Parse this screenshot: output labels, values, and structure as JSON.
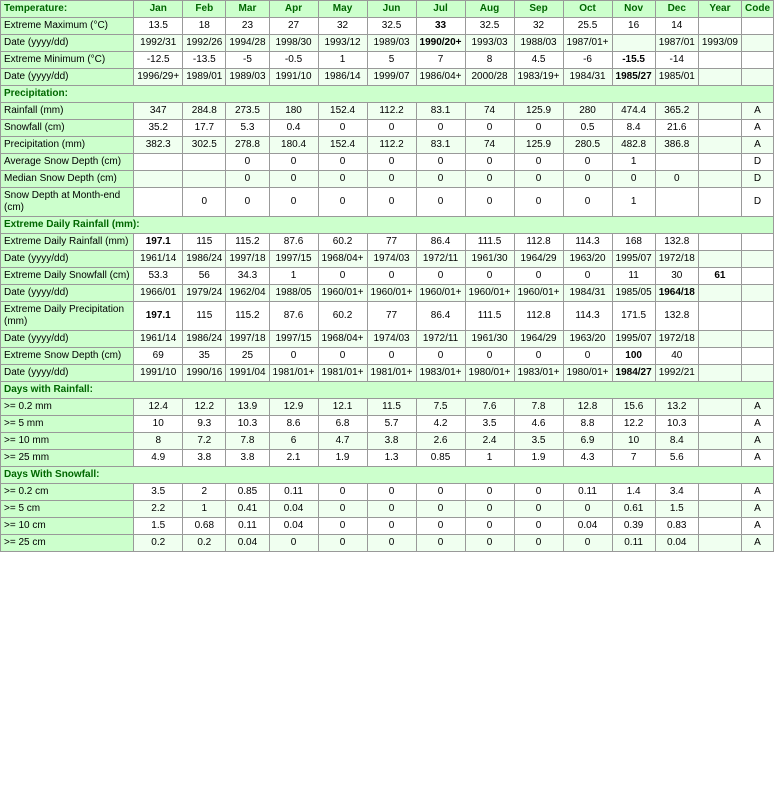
{
  "table": {
    "columns": [
      "",
      "Jan",
      "Feb",
      "Mar",
      "Apr",
      "May",
      "Jun",
      "Jul",
      "Aug",
      "Sep",
      "Oct",
      "Nov",
      "Dec",
      "Year",
      "Code"
    ],
    "sections": [
      {
        "header": "Temperature:",
        "rows": [
          {
            "label": "Extreme Maximum (°C)",
            "values": [
              "13.5",
              "18",
              "23",
              "27",
              "32",
              "32.5",
              "33",
              "32.5",
              "32",
              "25.5",
              "16",
              "14",
              "",
              ""
            ],
            "bold_indices": [
              6
            ]
          },
          {
            "label": "Date (yyyy/dd)",
            "values": [
              "1992/31",
              "1992/26",
              "1994/28",
              "1998/30",
              "1993/12",
              "1989/03",
              "1990/20+",
              "1993/03",
              "1988/03",
              "1987/01+",
              "",
              "1987/01",
              "1993/09"
            ],
            "bold_indices": [
              6
            ]
          },
          {
            "label": "Extreme Minimum (°C)",
            "values": [
              "-12.5",
              "-13.5",
              "-5",
              "-0.5",
              "1",
              "5",
              "7",
              "8",
              "4.5",
              "-6",
              "-15.5",
              "-14",
              "",
              ""
            ],
            "bold_indices": [
              10
            ]
          },
          {
            "label": "Date (yyyy/dd)",
            "values": [
              "1996/29+",
              "1989/01",
              "1989/03",
              "1991/10",
              "1986/14",
              "1999/07",
              "1986/04+",
              "2000/28",
              "1983/19+",
              "1984/31",
              "1985/27",
              "1985/01"
            ],
            "bold_indices": [
              10
            ]
          }
        ]
      },
      {
        "header": "Precipitation:",
        "rows": [
          {
            "label": "Rainfall (mm)",
            "values": [
              "347",
              "284.8",
              "273.5",
              "180",
              "152.4",
              "112.2",
              "83.1",
              "74",
              "125.9",
              "280",
              "474.4",
              "365.2",
              "",
              "A"
            ],
            "bold_indices": []
          },
          {
            "label": "Snowfall (cm)",
            "values": [
              "35.2",
              "17.7",
              "5.3",
              "0.4",
              "0",
              "0",
              "0",
              "0",
              "0",
              "0.5",
              "8.4",
              "21.6",
              "",
              "A"
            ],
            "bold_indices": []
          },
          {
            "label": "Precipitation (mm)",
            "values": [
              "382.3",
              "302.5",
              "278.8",
              "180.4",
              "152.4",
              "112.2",
              "83.1",
              "74",
              "125.9",
              "280.5",
              "482.8",
              "386.8",
              "",
              "A"
            ],
            "bold_indices": []
          },
          {
            "label": "Average Snow Depth (cm)",
            "values": [
              "",
              "",
              "0",
              "0",
              "0",
              "0",
              "0",
              "0",
              "0",
              "0",
              "1",
              "",
              "",
              "D"
            ],
            "bold_indices": []
          },
          {
            "label": "Median Snow Depth (cm)",
            "values": [
              "",
              "",
              "0",
              "0",
              "0",
              "0",
              "0",
              "0",
              "0",
              "0",
              "0",
              "0",
              "",
              "D"
            ],
            "bold_indices": []
          },
          {
            "label": "Snow Depth at Month-end (cm)",
            "values": [
              "",
              "0",
              "0",
              "0",
              "0",
              "0",
              "0",
              "0",
              "0",
              "0",
              "1",
              "",
              "",
              "D"
            ],
            "bold_indices": []
          }
        ]
      },
      {
        "header": "Extreme Daily Rainfall (mm):",
        "rows": [
          {
            "label": "Extreme Daily Rainfall (mm)",
            "values": [
              "197.1",
              "115",
              "115.2",
              "87.6",
              "60.2",
              "77",
              "86.4",
              "111.5",
              "112.8",
              "114.3",
              "168",
              "132.8",
              "",
              ""
            ],
            "bold_indices": [
              0
            ]
          },
          {
            "label": "Date (yyyy/dd)",
            "values": [
              "1961/14",
              "1986/24",
              "1997/18",
              "1997/15",
              "1968/04+",
              "1974/03",
              "1972/11",
              "1961/30",
              "1964/29",
              "1963/20",
              "1995/07",
              "1972/18"
            ],
            "bold_indices": []
          },
          {
            "label": "Extreme Daily Snowfall (cm)",
            "values": [
              "53.3",
              "56",
              "34.3",
              "1",
              "0",
              "0",
              "0",
              "0",
              "0",
              "0",
              "11",
              "30",
              "61",
              ""
            ],
            "bold_indices": [
              12
            ]
          },
          {
            "label": "Date (yyyy/dd)",
            "values": [
              "1966/01",
              "1979/24",
              "1962/04",
              "1988/05",
              "1960/01+",
              "1960/01+",
              "1960/01+",
              "1960/01+",
              "1960/01+",
              "1984/31",
              "1985/05",
              "1964/18"
            ],
            "bold_indices": [
              11
            ]
          },
          {
            "label": "Extreme Daily Precipitation (mm)",
            "values": [
              "197.1",
              "115",
              "115.2",
              "87.6",
              "60.2",
              "77",
              "86.4",
              "111.5",
              "112.8",
              "114.3",
              "171.5",
              "132.8",
              "",
              ""
            ],
            "bold_indices": [
              0
            ]
          },
          {
            "label": "Date (yyyy/dd)",
            "values": [
              "1961/14",
              "1986/24",
              "1997/18",
              "1997/15",
              "1968/04+",
              "1974/03",
              "1972/11",
              "1961/30",
              "1964/29",
              "1963/20",
              "1995/07",
              "1972/18"
            ],
            "bold_indices": []
          },
          {
            "label": "Extreme Snow Depth (cm)",
            "values": [
              "69",
              "35",
              "25",
              "0",
              "0",
              "0",
              "0",
              "0",
              "0",
              "0",
              "100",
              "40",
              "",
              ""
            ],
            "bold_indices": [
              10
            ]
          },
          {
            "label": "Date (yyyy/dd)",
            "values": [
              "1991/10",
              "1990/16",
              "1991/04",
              "1981/01+",
              "1981/01+",
              "1981/01+",
              "1983/01+",
              "1980/01+",
              "1983/01+",
              "1980/01+",
              "1984/27",
              "1992/21"
            ],
            "bold_indices": [
              10
            ]
          }
        ]
      },
      {
        "header": "Days with Rainfall:",
        "rows": [
          {
            "label": ">= 0.2 mm",
            "values": [
              "12.4",
              "12.2",
              "13.9",
              "12.9",
              "12.1",
              "11.5",
              "7.5",
              "7.6",
              "7.8",
              "12.8",
              "15.6",
              "13.2",
              "",
              "A"
            ],
            "bold_indices": []
          },
          {
            "label": ">= 5 mm",
            "values": [
              "10",
              "9.3",
              "10.3",
              "8.6",
              "6.8",
              "5.7",
              "4.2",
              "3.5",
              "4.6",
              "8.8",
              "12.2",
              "10.3",
              "",
              "A"
            ],
            "bold_indices": []
          },
          {
            "label": ">= 10 mm",
            "values": [
              "8",
              "7.2",
              "7.8",
              "6",
              "4.7",
              "3.8",
              "2.6",
              "2.4",
              "3.5",
              "6.9",
              "10",
              "8.4",
              "",
              "A"
            ],
            "bold_indices": []
          },
          {
            "label": ">= 25 mm",
            "values": [
              "4.9",
              "3.8",
              "3.8",
              "2.1",
              "1.9",
              "1.3",
              "0.85",
              "1",
              "1.9",
              "4.3",
              "7",
              "5.6",
              "",
              "A"
            ],
            "bold_indices": []
          }
        ]
      },
      {
        "header": "Days With Snowfall:",
        "rows": [
          {
            "label": ">= 0.2 cm",
            "values": [
              "3.5",
              "2",
              "0.85",
              "0.11",
              "0",
              "0",
              "0",
              "0",
              "0",
              "0.11",
              "1.4",
              "3.4",
              "",
              "A"
            ],
            "bold_indices": []
          },
          {
            "label": ">= 5 cm",
            "values": [
              "2.2",
              "1",
              "0.41",
              "0.04",
              "0",
              "0",
              "0",
              "0",
              "0",
              "0",
              "0.61",
              "1.5",
              "",
              "A"
            ],
            "bold_indices": []
          },
          {
            "label": ">= 10 cm",
            "values": [
              "1.5",
              "0.68",
              "0.11",
              "0.04",
              "0",
              "0",
              "0",
              "0",
              "0",
              "0.04",
              "0.39",
              "0.83",
              "",
              "A"
            ],
            "bold_indices": []
          },
          {
            "label": ">= 25 cm",
            "values": [
              "0.2",
              "0.2",
              "0.04",
              "0",
              "0",
              "0",
              "0",
              "0",
              "0",
              "0",
              "0.11",
              "0.04",
              "",
              "A"
            ],
            "bold_indices": []
          }
        ]
      }
    ]
  }
}
